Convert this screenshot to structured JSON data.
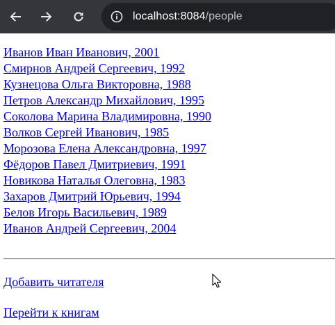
{
  "browser": {
    "back_icon": "arrow-left-icon",
    "forward_icon": "arrow-right-icon",
    "reload_icon": "reload-icon",
    "site_info_icon": "info-circle-icon",
    "url_host": "localhost:8084",
    "url_path": "/people",
    "colors": {
      "toolbar_bg": "#35363a",
      "omnibox_bg": "#202124",
      "icon": "#e8eaed"
    }
  },
  "people": [
    "Иванов Иван Иванович, 2001",
    "Смирнов Андрей Сергеевич, 1992",
    "Кузнецова Ольга Викторовна, 1988",
    "Петров Александр Михайлович, 1995",
    "Соколова Марина Владимировна, 1990",
    "Волков Сергей Иванович, 1985",
    "Морозова Елена Александровна, 1997",
    "Фёдоров Павел Дмитриевич, 1991",
    "Новикова Наталья Олеговна, 1983",
    "Захаров Дмитрий Юрьевич, 1994",
    "Белов Игорь Васильевич, 1989",
    "Иванов Андрей Сергеевич, 2004"
  ],
  "links": {
    "add_reader": "Добавить читателя",
    "go_to_books": "Перейти к книгам",
    "link_color": "#0000ee"
  }
}
